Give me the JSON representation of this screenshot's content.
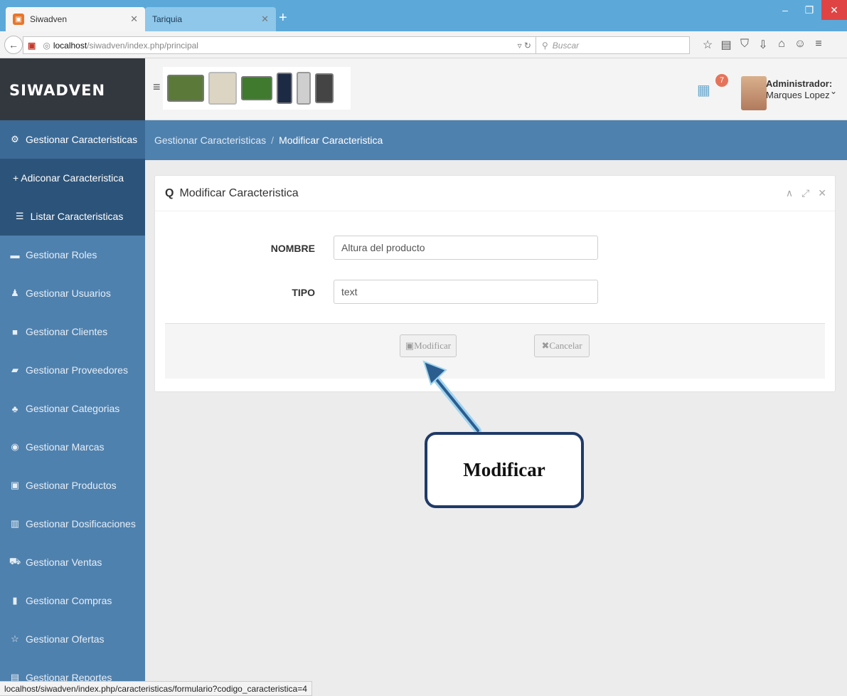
{
  "browser": {
    "tabs": [
      {
        "label": "Siwadven",
        "close": "✕"
      },
      {
        "label": "Tariquia",
        "close": "✕"
      }
    ],
    "new_tab": "+",
    "url_host": "localhost",
    "url_path": "/siwadven/index.php/principal",
    "search_placeholder": "Buscar",
    "status_url": "localhost/siwadven/index.php/caracteristicas/formulario?codigo_caracteristica=4"
  },
  "app": {
    "brand": "SIWADVEN",
    "notification_count": "7",
    "user_role": "Administrador:",
    "user_name": "Marques Lopez"
  },
  "sidebar": {
    "items": [
      {
        "label": "Gestionar Caracteristicas",
        "icon": "cogs-icon"
      },
      {
        "label": "+ Adiconar Caracteristica",
        "icon": "plus-icon"
      },
      {
        "label": "Listar Caracteristicas",
        "icon": "list-icon"
      },
      {
        "label": "Gestionar Roles",
        "icon": "card-icon"
      },
      {
        "label": "Gestionar Usuarios",
        "icon": "users-icon"
      },
      {
        "label": "Gestionar Clientes",
        "icon": "briefcase-icon"
      },
      {
        "label": "Gestionar Proveedores",
        "icon": "truck-icon"
      },
      {
        "label": "Gestionar Categorias",
        "icon": "sitemap-icon"
      },
      {
        "label": "Gestionar Marcas",
        "icon": "record-icon"
      },
      {
        "label": "Gestionar Productos",
        "icon": "box-icon"
      },
      {
        "label": "Gestionar Dosificaciones",
        "icon": "calculator-icon"
      },
      {
        "label": "Gestionar Ventas",
        "icon": "cart-icon"
      },
      {
        "label": "Gestionar Compras",
        "icon": "book-icon"
      },
      {
        "label": "Gestionar Ofertas",
        "icon": "star-icon"
      },
      {
        "label": "Gestionar Reportes",
        "icon": "report-icon"
      }
    ]
  },
  "breadcrumb": {
    "parent": "Gestionar Caracteristicas",
    "separator": "/",
    "current": "Modificar Caracteristica"
  },
  "panel": {
    "title": "Modificar Caracteristica",
    "fields": [
      {
        "label": "NOMBRE",
        "value": "Altura del producto"
      },
      {
        "label": "TIPO",
        "value": "text"
      }
    ],
    "modify_button": "Modificar",
    "cancel_button": "Cancelar"
  },
  "annotation": {
    "label": "Modificar"
  }
}
